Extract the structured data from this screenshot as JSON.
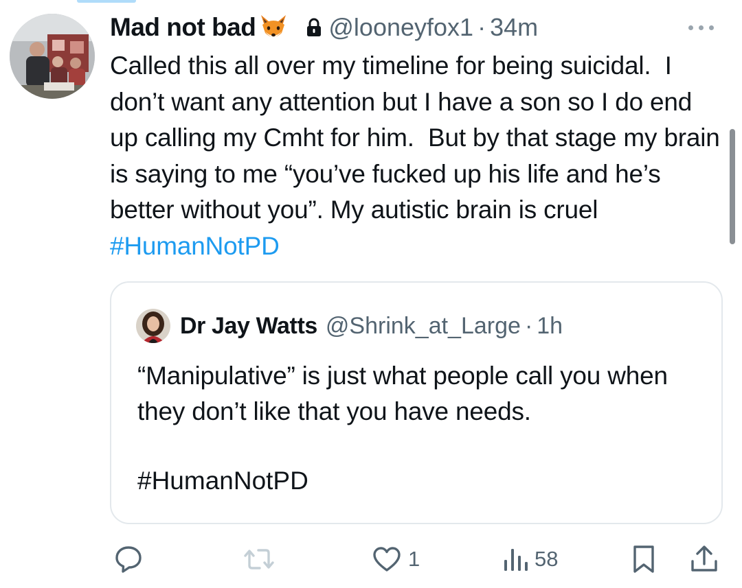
{
  "post": {
    "display_name": "Mad not bad",
    "name_emoji": "fox-face-emoji",
    "badge_icon": "lock-icon",
    "handle": "@looneyfox1",
    "separator": "·",
    "time": "34m",
    "text": "Called this all over my timeline for being suicidal.  I don’t want any attention but I have a son so I do end up calling my Cmht for him.  But by that stage my brain is saying to me “you’ve fucked up his life and he’s better without you”. My autistic brain is cruel ",
    "hashtag": "#HumanNotPD"
  },
  "quoted_post": {
    "display_name": "Dr Jay Watts",
    "handle": "@Shrink_at_Large",
    "separator": "·",
    "time": "1h",
    "text": "“Manipulative” is just what people call you when they don’t like that you have needs.",
    "hashtag": "#HumanNotPD"
  },
  "actions": {
    "reply_count": "",
    "repost_count": "",
    "like_count": "1",
    "views_count": "58"
  },
  "colors": {
    "link": "#1d9bf0",
    "secondary_text": "#536471",
    "primary_text": "#0f1419",
    "border": "#e3e8ec",
    "repost_disabled": "#c4cfd6"
  }
}
